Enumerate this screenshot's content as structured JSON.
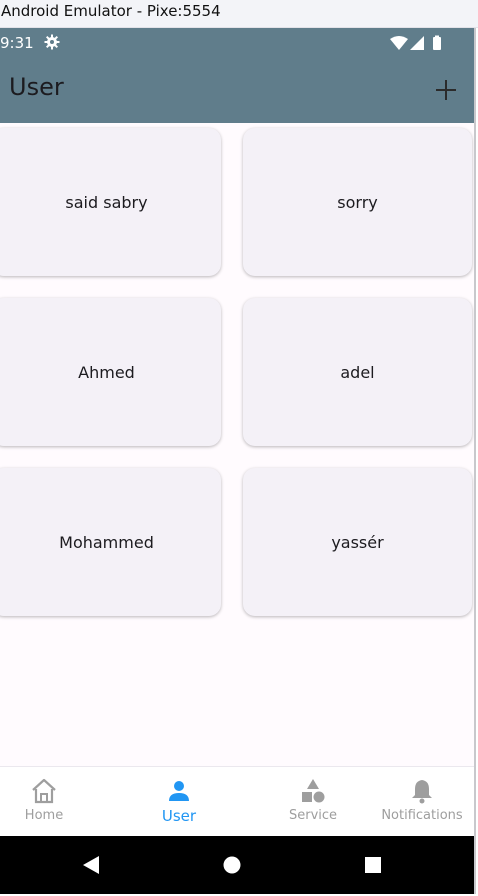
{
  "window": {
    "title": "Android Emulator - Pixe:5554"
  },
  "status_bar": {
    "time": "9:31",
    "icons": [
      "gear-icon",
      "wifi-icon",
      "signal-icon",
      "battery-icon"
    ]
  },
  "app_bar": {
    "title": "User",
    "add_icon": "plus-icon"
  },
  "cards": [
    {
      "label": "said sabry"
    },
    {
      "label": "sorry"
    },
    {
      "label": "Ahmed"
    },
    {
      "label": "adel"
    },
    {
      "label": "Mohammed"
    },
    {
      "label": "yassér"
    }
  ],
  "bottom_nav": {
    "items": [
      {
        "label": "Home",
        "icon": "home-icon"
      },
      {
        "label": "User",
        "icon": "person-icon",
        "active": true
      },
      {
        "label": "Service",
        "icon": "shapes-icon"
      },
      {
        "label": "Notifications",
        "icon": "bell-icon"
      }
    ]
  },
  "system_nav": {
    "icons": [
      "back-icon",
      "home-circle-icon",
      "recents-icon"
    ]
  },
  "colors": {
    "app_bar": "#607d8b",
    "background": "#fffbfe",
    "card": "#f4f1f7",
    "active_nav": "#2196f3",
    "inactive_nav": "#9e9e9e"
  }
}
